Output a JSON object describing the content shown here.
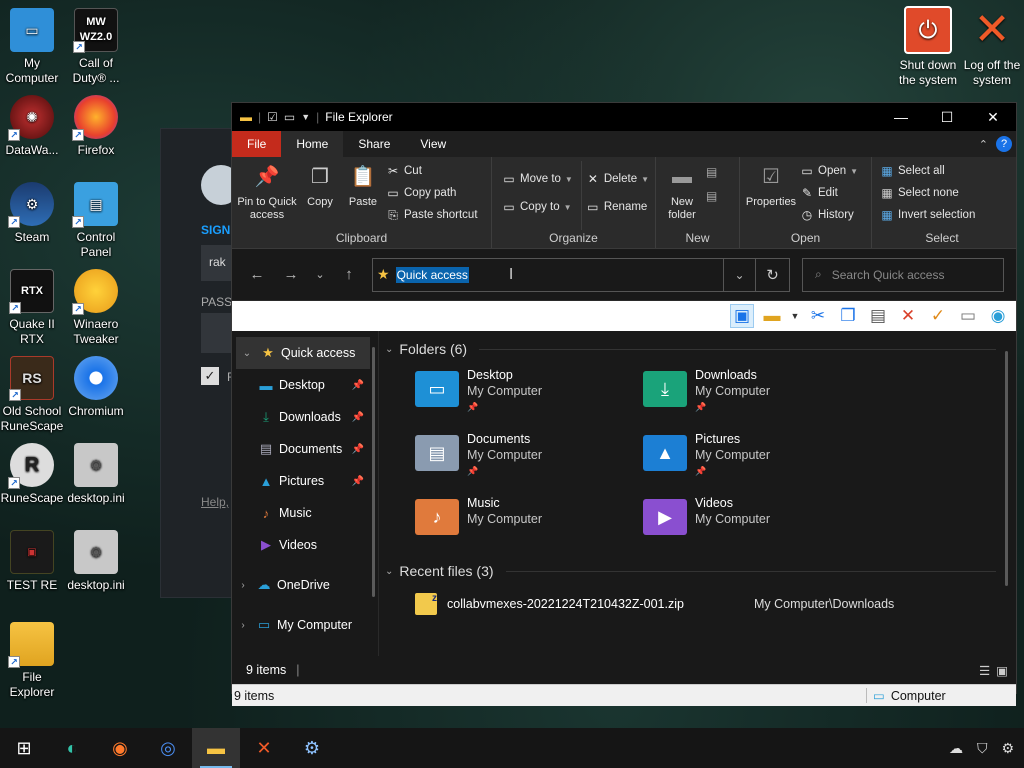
{
  "desktop": {
    "icons": [
      {
        "label": "My Computer",
        "icon": "monitor-icon"
      },
      {
        "label": "Call of Duty® ...",
        "icon": "cod-icon"
      },
      {
        "label": "DataWa...",
        "icon": "datawa-icon"
      },
      {
        "label": "Firefox",
        "icon": "firefox-icon"
      },
      {
        "label": "Steam",
        "icon": "steam-icon"
      },
      {
        "label": "Control Panel",
        "icon": "control-panel-icon"
      },
      {
        "label": "Quake II RTX",
        "icon": "quake-icon"
      },
      {
        "label": "Winaero Tweaker",
        "icon": "winaero-icon"
      },
      {
        "label": "Old School RuneScape",
        "icon": "osrs-icon"
      },
      {
        "label": "Chromium",
        "icon": "chromium-icon"
      },
      {
        "label": "RuneScape",
        "icon": "runescape-icon"
      },
      {
        "label": "desktop.ini",
        "icon": "ini-file-icon"
      },
      {
        "label": "TEST RE",
        "icon": "test-re-icon"
      },
      {
        "label": "desktop.ini",
        "icon": "ini-file-icon"
      },
      {
        "label": "File Explorer",
        "icon": "file-explorer-icon"
      }
    ],
    "sys_icons": [
      {
        "label": "Shut down the system",
        "icon": "power-icon"
      },
      {
        "label": "Log off the system",
        "icon": "logoff-icon"
      }
    ],
    "cod_badge_top": "MW",
    "cod_badge_bottom": "WZ2.0",
    "rtx_badge": "RTX",
    "behind_window": {
      "sign": "SIGN",
      "input_value": "rak",
      "pass_label": "PASSW",
      "check_label": "R",
      "help_link": "Help,"
    }
  },
  "explorer": {
    "title": "File Explorer",
    "tabs": [
      "File",
      "Home",
      "Share",
      "View"
    ],
    "active_tab": "Home",
    "ribbon": {
      "clipboard": {
        "label": "Clipboard",
        "pin": "Pin to Quick access",
        "copy": "Copy",
        "paste": "Paste",
        "cut": "Cut",
        "copy_path": "Copy path",
        "paste_shortcut": "Paste shortcut"
      },
      "organize": {
        "label": "Organize",
        "move_to": "Move to",
        "copy_to": "Copy to",
        "delete": "Delete",
        "rename": "Rename"
      },
      "new": {
        "label": "New",
        "new_folder": "New folder"
      },
      "open": {
        "label": "Open",
        "properties": "Properties",
        "open": "Open",
        "edit": "Edit",
        "history": "History"
      },
      "select": {
        "label": "Select",
        "select_all": "Select all",
        "select_none": "Select none",
        "invert": "Invert selection"
      }
    },
    "address": "Quick access",
    "search_placeholder": "Search Quick access",
    "nav": [
      {
        "label": "Quick access",
        "icon": "star-icon"
      },
      {
        "label": "Desktop",
        "icon": "desktop-folder-icon"
      },
      {
        "label": "Downloads",
        "icon": "downloads-icon"
      },
      {
        "label": "Documents",
        "icon": "documents-icon"
      },
      {
        "label": "Pictures",
        "icon": "pictures-icon"
      },
      {
        "label": "Music",
        "icon": "music-icon"
      },
      {
        "label": "Videos",
        "icon": "videos-icon"
      },
      {
        "label": "OneDrive",
        "icon": "onedrive-icon"
      },
      {
        "label": "My Computer",
        "icon": "computer-icon"
      }
    ],
    "folders_header": "Folders (6)",
    "folders": [
      {
        "name": "Desktop",
        "location": "My Computer",
        "color": "#1e90d6"
      },
      {
        "name": "Downloads",
        "location": "My Computer",
        "color": "#1aa37a"
      },
      {
        "name": "Documents",
        "location": "My Computer",
        "color": "#8a9bb0"
      },
      {
        "name": "Pictures",
        "location": "My Computer",
        "color": "#1c7fd4"
      },
      {
        "name": "Music",
        "location": "My Computer",
        "color": "#e07a3c"
      },
      {
        "name": "Videos",
        "location": "My Computer",
        "color": "#8a4fd0"
      }
    ],
    "recent_header": "Recent files (3)",
    "recent": [
      {
        "name": "collabvmexes-20221224T210432Z-001.zip",
        "path": "My Computer\\Downloads"
      }
    ],
    "inner_status": "9 items",
    "outer_status": "9 items",
    "outer_status_right": "Computer"
  },
  "taskbar": {
    "items": [
      "windows-start-icon",
      "edge-icon",
      "firefox-icon",
      "chromium-icon",
      "file-explorer-icon",
      "x-app-icon",
      "steam-icon"
    ],
    "active": "file-explorer-icon"
  }
}
